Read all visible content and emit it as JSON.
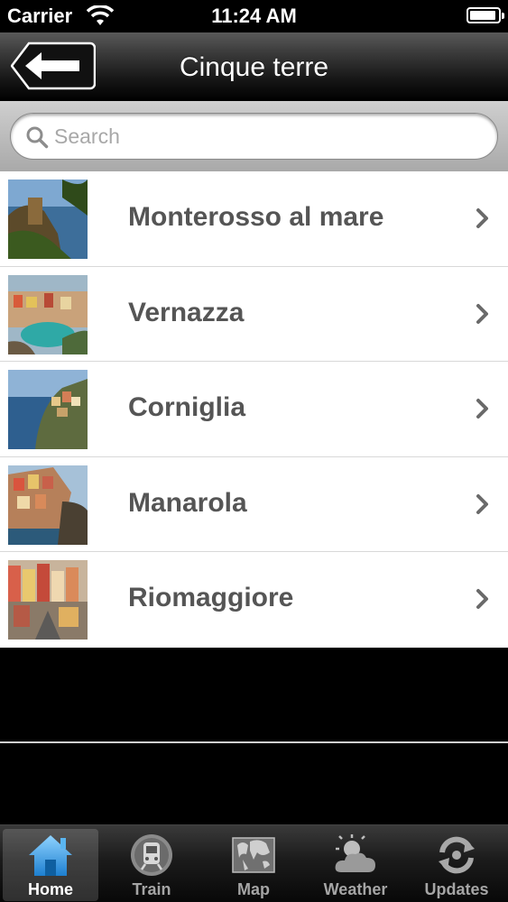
{
  "status": {
    "carrier": "Carrier",
    "time": "11:24 AM"
  },
  "nav": {
    "title": "Cinque terre",
    "back_icon": "back-arrow-icon"
  },
  "search": {
    "placeholder": "Search",
    "value": ""
  },
  "list": {
    "items": [
      {
        "label": "Monterosso al mare",
        "thumb": "monterosso-photo"
      },
      {
        "label": "Vernazza",
        "thumb": "vernazza-photo"
      },
      {
        "label": "Corniglia",
        "thumb": "corniglia-photo"
      },
      {
        "label": "Manarola",
        "thumb": "manarola-photo"
      },
      {
        "label": "Riomaggiore",
        "thumb": "riomaggiore-photo"
      }
    ]
  },
  "tabs": [
    {
      "label": "Home",
      "icon": "home-icon",
      "active": true
    },
    {
      "label": "Train",
      "icon": "train-icon",
      "active": false
    },
    {
      "label": "Map",
      "icon": "map-icon",
      "active": false
    },
    {
      "label": "Weather",
      "icon": "weather-icon",
      "active": false
    },
    {
      "label": "Updates",
      "icon": "updates-icon",
      "active": false
    }
  ],
  "colors": {
    "accent": "#3aa3e8",
    "label": "#555555"
  }
}
